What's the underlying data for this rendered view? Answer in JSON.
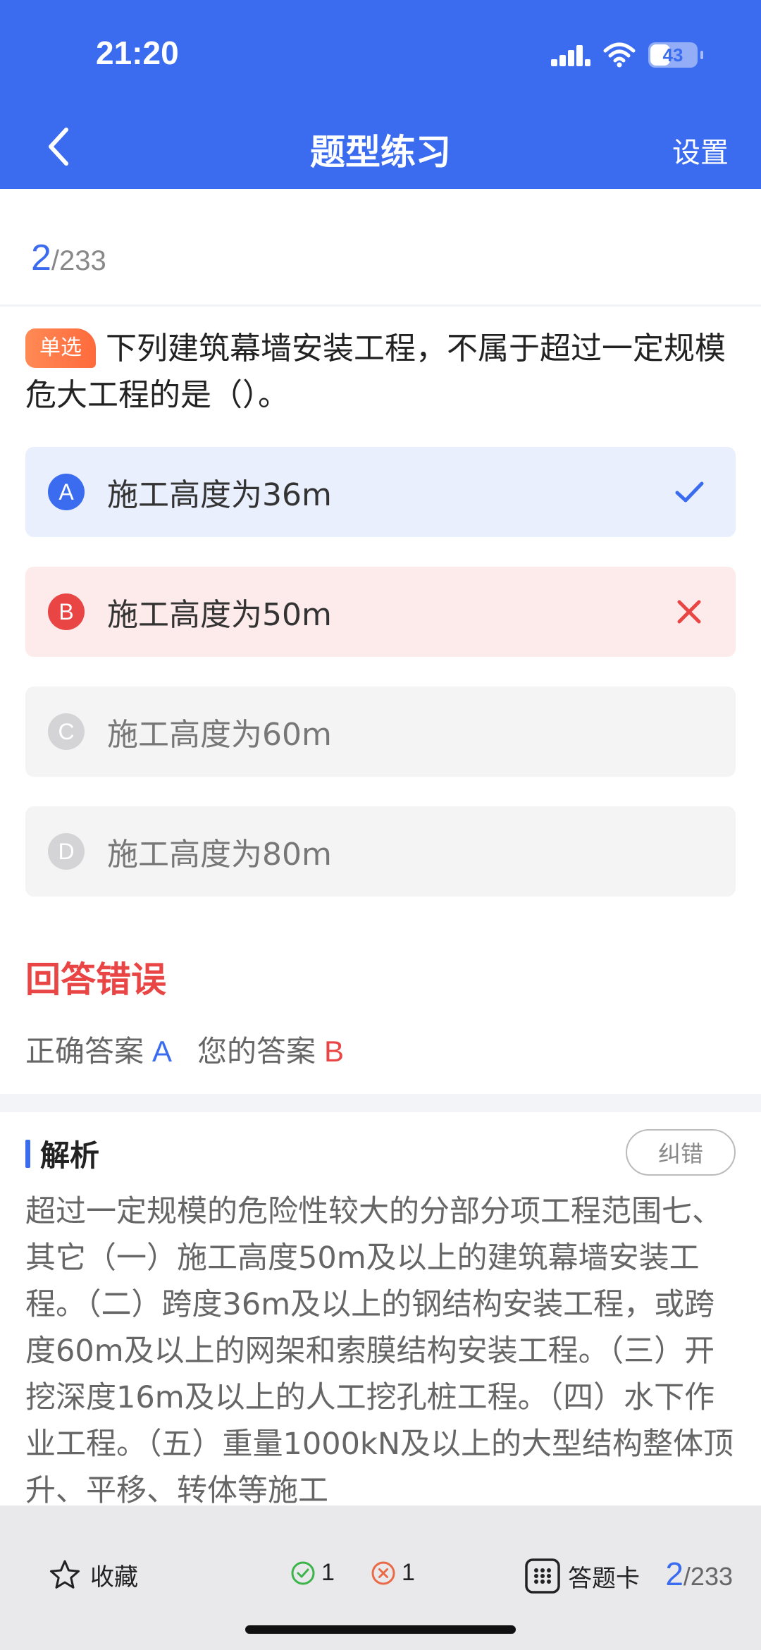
{
  "status_bar": {
    "time": "21:20",
    "battery_percent": "43",
    "battery_level": 0.43
  },
  "nav": {
    "title": "题型练习",
    "settings_label": "设置"
  },
  "progress": {
    "current": "2",
    "total": "/233"
  },
  "question": {
    "type_label": "单选",
    "text": "下列建筑幕墙安装工程，不属于超过一定规模危大工程的是（）。"
  },
  "options": [
    {
      "letter": "A",
      "text": "施工高度为36m",
      "state": "correct"
    },
    {
      "letter": "B",
      "text": "施工高度为50m",
      "state": "wrong"
    },
    {
      "letter": "C",
      "text": "施工高度为60m",
      "state": "none"
    },
    {
      "letter": "D",
      "text": "施工高度为80m",
      "state": "none"
    }
  ],
  "result": {
    "title": "回答错误",
    "correct_label": "正确答案",
    "correct_value": "A",
    "your_label": "您的答案",
    "your_value": "B"
  },
  "analysis": {
    "title": "解析",
    "report_label": "纠错",
    "text": "超过一定规模的危险性较大的分部分项工程范围七、其它（一）施工高度50m及以上的建筑幕墙安装工程。（二）跨度36m及以上的钢结构安装工程，或跨度60m及以上的网架和索膜结构安装工程。（三）开挖深度16m及以上的人工挖孔桩工程。（四）水下作业工程。（五）重量1000kN及以上的大型结构整体顶升、平移、转体等施工"
  },
  "bottom_bar": {
    "favorite_label": "收藏",
    "correct_count": "1",
    "wrong_count": "1",
    "answer_card_label": "答题卡",
    "current": "2",
    "total": "/233"
  },
  "colors": {
    "primary": "#3b6cf0",
    "error": "#e94545",
    "success": "#3bb44a"
  },
  "icons": [
    "back-icon",
    "signal-icon",
    "wifi-icon",
    "battery-icon",
    "check-icon",
    "cross-icon",
    "star-icon",
    "check-circle-icon",
    "x-circle-icon",
    "grid-icon"
  ]
}
